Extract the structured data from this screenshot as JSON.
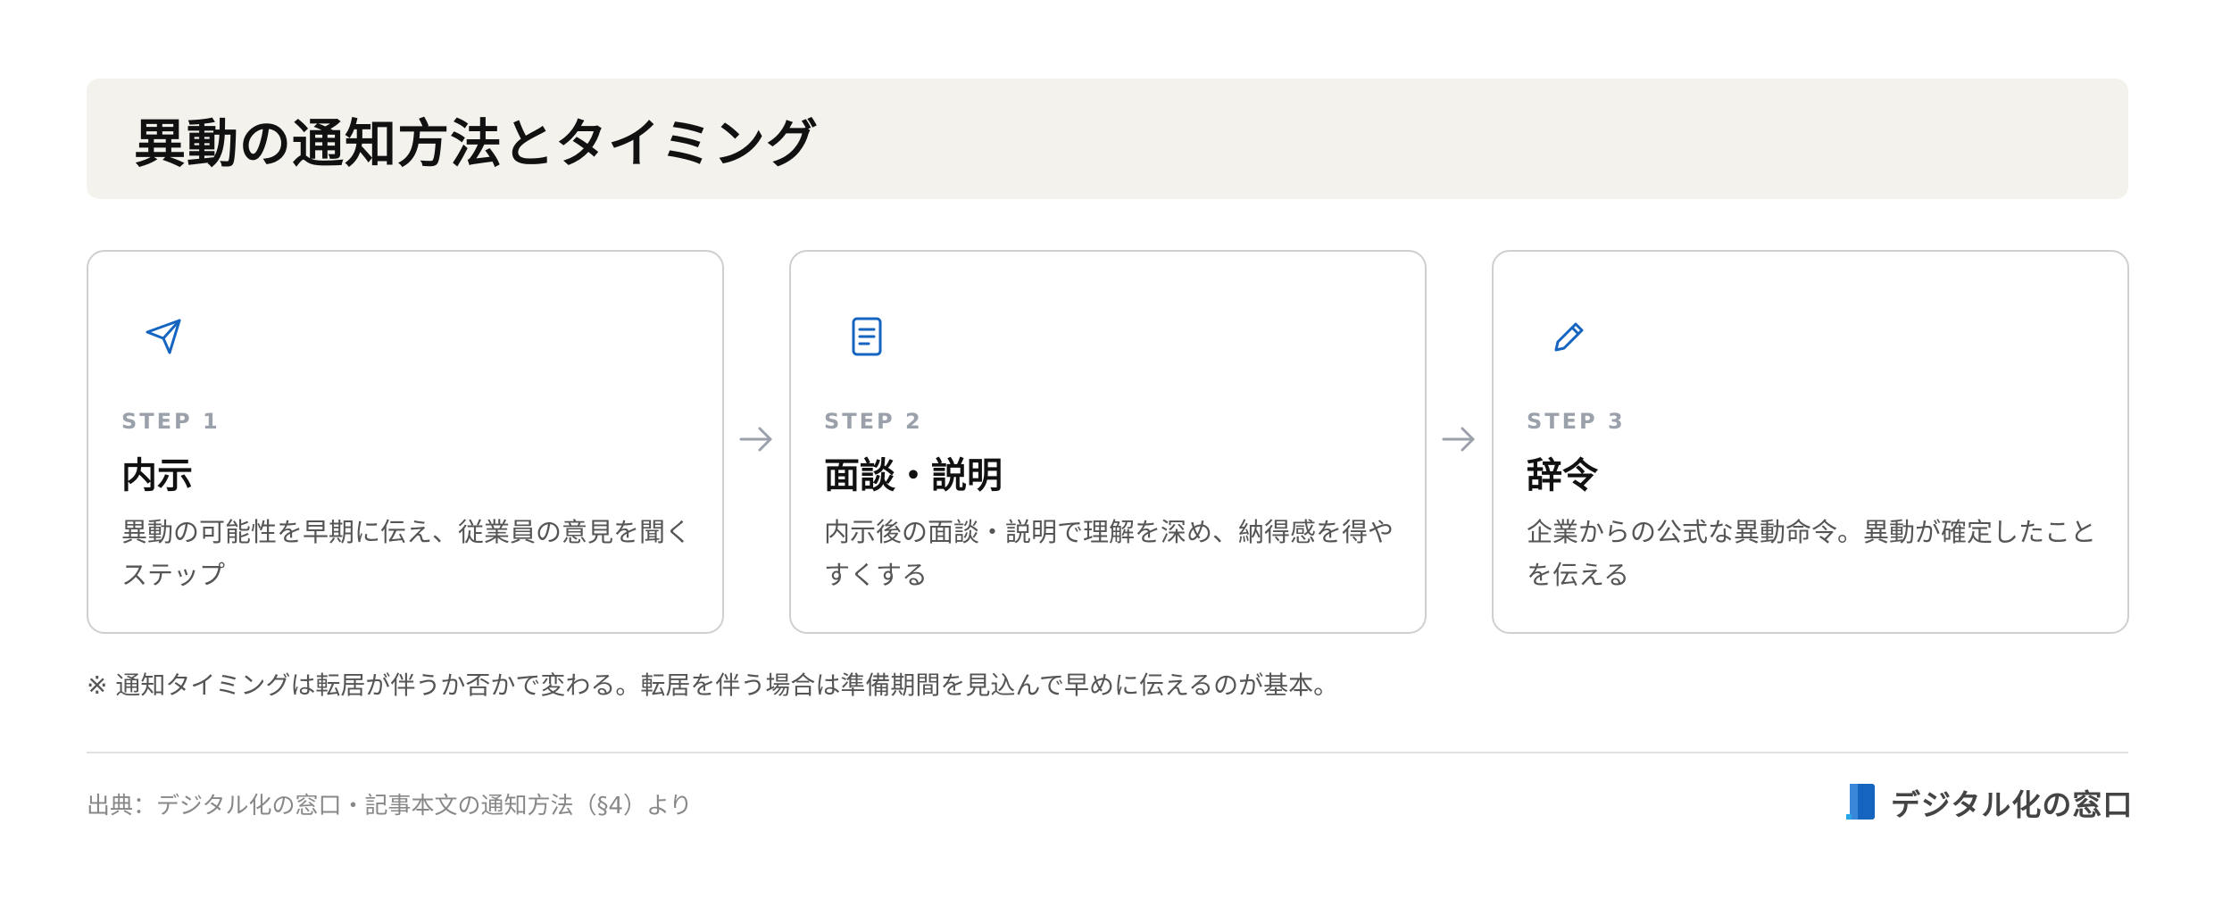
{
  "title": "異動の通知方法とタイミング",
  "steps": [
    {
      "icon": "paper-plane-icon",
      "label": "STEP 1",
      "title": "内示",
      "description": "異動の可能性を早期に伝え、従業員の意見を聞くステップ"
    },
    {
      "icon": "document-icon",
      "label": "STEP 2",
      "title": "面談・説明",
      "description": "内示後の面談・説明で理解を深め、納得感を得やすくする"
    },
    {
      "icon": "pencil-icon",
      "label": "STEP 3",
      "title": "辞令",
      "description": "企業からの公式な異動命令。異動が確定したことを伝える"
    }
  ],
  "note": "※ 通知タイミングは転居が伴うか否かで変わる。転居を伴う場合は準備期間を見込んで早めに伝えるのが基本。",
  "source": "出典：デジタル化の窓口・記事本文の通知方法（§4）より",
  "logo": {
    "text": "デジタル化の窓口"
  },
  "colors": {
    "accent": "#1565c0",
    "title_band": "#f4f2ec",
    "step_label": "#9aa1ab",
    "arrow": "#9aa1ab"
  }
}
